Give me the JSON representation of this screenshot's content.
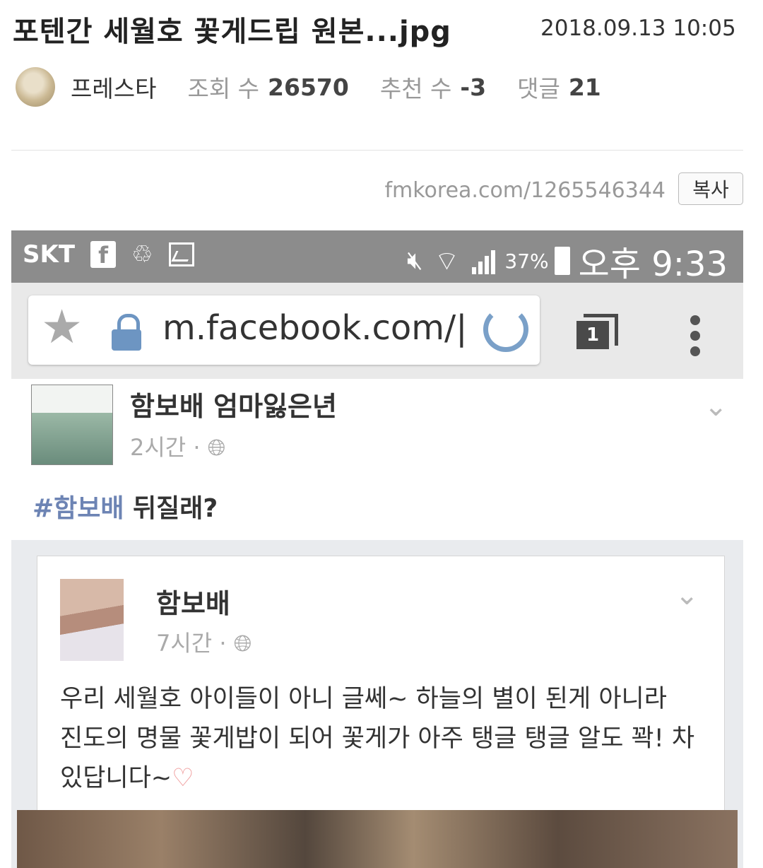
{
  "post": {
    "title": "포텐간 세월호 꽃게드립 원본...jpg",
    "date": "2018.09.13 10:05",
    "author": "프레스타",
    "views_label": "조회 수",
    "views": "26570",
    "recommend_label": "추천 수",
    "recommend": "-3",
    "comments_label": "댓글",
    "comments": "21",
    "url": "fmkorea.com/1265546344",
    "copy_label": "복사"
  },
  "screenshot": {
    "status_bar": {
      "carrier": "SKT",
      "fb_icon": "f",
      "battery": "37%",
      "time": "오후 9:33"
    },
    "browser": {
      "url": "m.facebook.com/|",
      "tab_count": "1"
    },
    "post": {
      "author": "함보배 엄마잃은년",
      "time": "2시간 ·",
      "hashtag": "#함보배",
      "text": " 뒤질래?"
    },
    "shared_post": {
      "author": "함보배",
      "time": "7시간 ·",
      "text": "우리 세월호 아이들이 아니 글쎄~ 하늘의 별이 된게 아니라 진도의 명물 꽃게밥이 되어 꽃게가 아주 탱글 탱글 알도 꽉! 차있답니다~",
      "emoji": "♡"
    }
  }
}
